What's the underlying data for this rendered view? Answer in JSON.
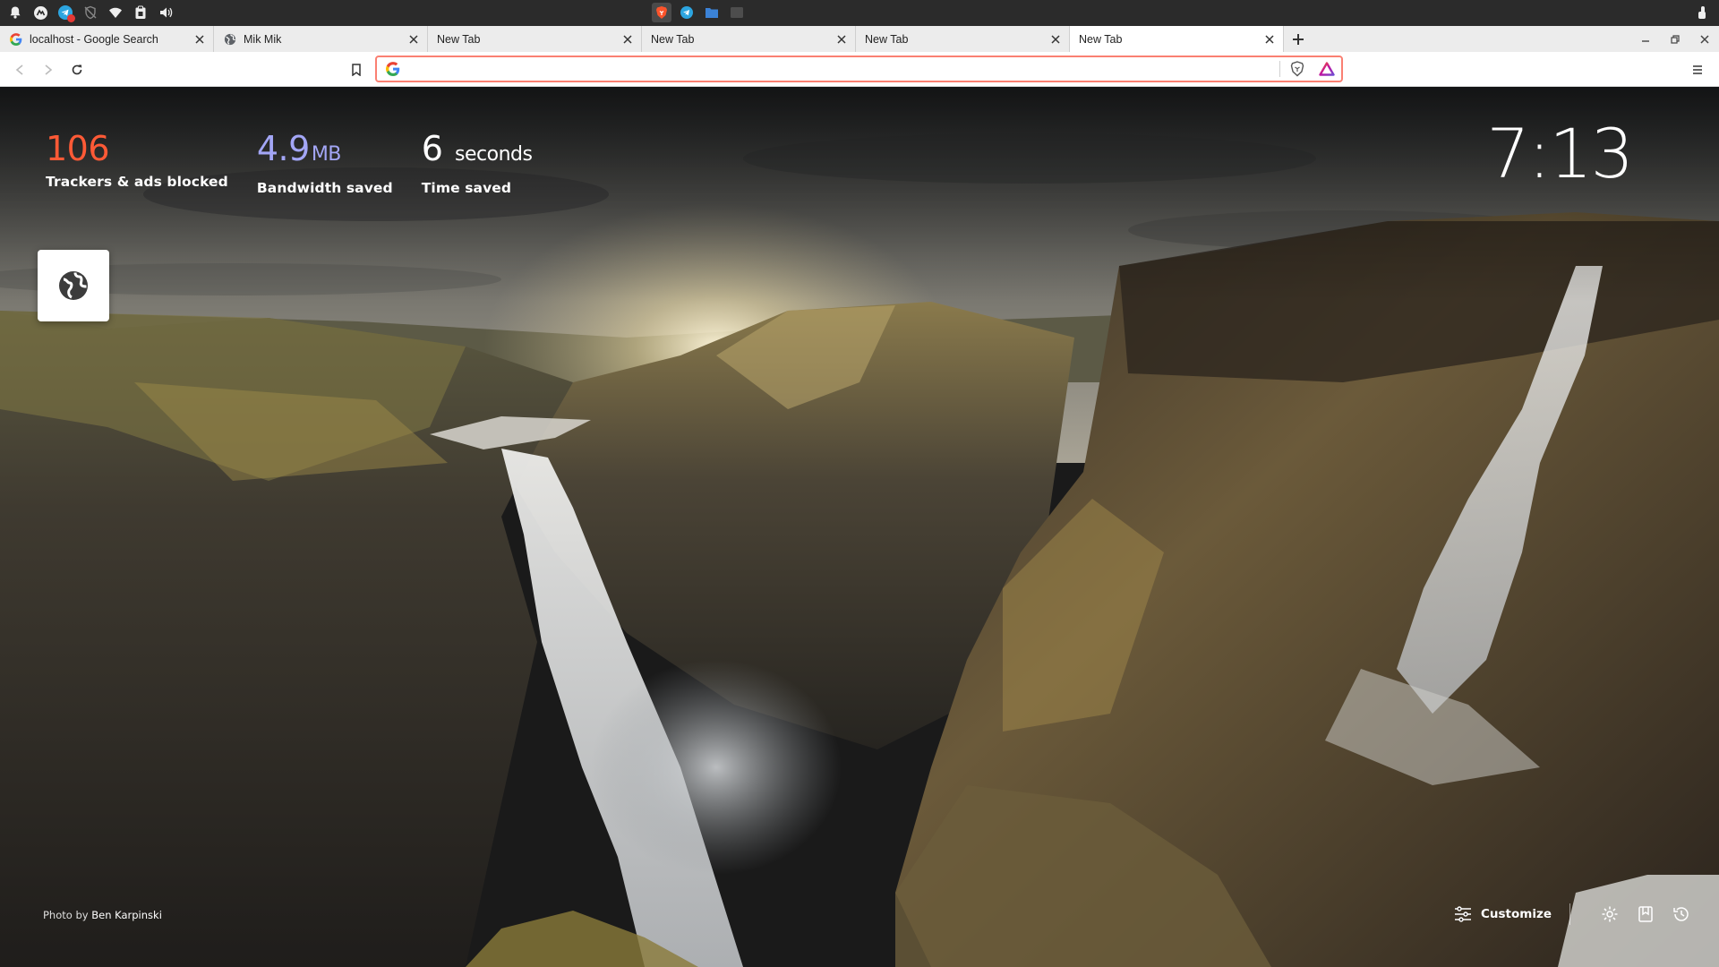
{
  "tabs": [
    {
      "label": "localhost - Google Search",
      "favicon": "google-icon"
    },
    {
      "label": "Mik Mik",
      "favicon": "globe-icon"
    },
    {
      "label": "New Tab",
      "favicon": ""
    },
    {
      "label": "New Tab",
      "favicon": ""
    },
    {
      "label": "New Tab",
      "favicon": ""
    },
    {
      "label": "New Tab",
      "favicon": "",
      "active": true
    }
  ],
  "address_bar": {
    "value": "",
    "placeholder": ""
  },
  "stats": {
    "trackers": {
      "value": "106",
      "label": "Trackers & ads blocked"
    },
    "bandwidth": {
      "value": "4.9",
      "unit": "MB",
      "label": "Bandwidth saved"
    },
    "time": {
      "value": "6",
      "unit": "seconds",
      "label": "Time saved"
    }
  },
  "clock": "7:13",
  "photo_credit": {
    "prefix": "Photo by",
    "author": "Ben Karpinski"
  },
  "customize_label": "Customize",
  "colors": {
    "trackers": "#ff5a36",
    "bandwidth": "#a3a6f6",
    "url_focus_border": "#fa8072",
    "brave_orange": "#fb542b"
  }
}
